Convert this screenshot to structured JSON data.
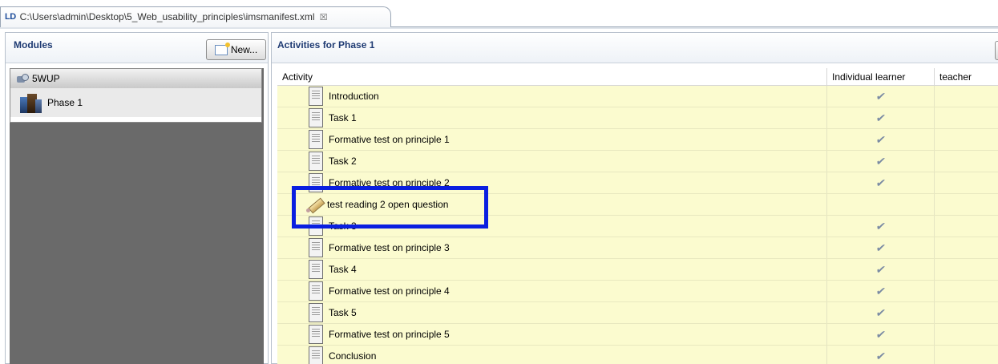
{
  "editor_tab": {
    "logo": "LD",
    "title": "C:\\Users\\admin\\Desktop\\5_Web_usability_principles\\imsmanifest.xml",
    "close": "☒"
  },
  "modules_panel": {
    "title": "Modules",
    "new_button": "New...",
    "tree": [
      {
        "label": "5WUP",
        "icon": "package-icon"
      },
      {
        "label": "Phase 1",
        "icon": "phase-icon"
      }
    ]
  },
  "activities_panel": {
    "title": "Activities for Phase 1",
    "columns": [
      "Activity",
      "Individual learner",
      "teacher"
    ],
    "check_glyph": "✔",
    "rows": [
      {
        "label": "Introduction",
        "icon": "document-icon",
        "learner": true,
        "teacher": false
      },
      {
        "label": "Task 1",
        "icon": "document-icon",
        "learner": true,
        "teacher": false
      },
      {
        "label": "Formative test on principle 1",
        "icon": "document-icon",
        "learner": true,
        "teacher": false
      },
      {
        "label": "Task 2",
        "icon": "document-icon",
        "learner": true,
        "teacher": false
      },
      {
        "label": "Formative test on principle 2",
        "icon": "document-icon",
        "learner": true,
        "teacher": false
      },
      {
        "label": "test reading 2 open question",
        "icon": "pen-icon",
        "learner": false,
        "teacher": true
      },
      {
        "label": "Task 3",
        "icon": "document-icon",
        "learner": true,
        "teacher": false
      },
      {
        "label": "Formative test on principle 3",
        "icon": "document-icon",
        "learner": true,
        "teacher": false
      },
      {
        "label": "Task 4",
        "icon": "document-icon",
        "learner": true,
        "teacher": false
      },
      {
        "label": "Formative test on principle 4",
        "icon": "document-icon",
        "learner": true,
        "teacher": false
      },
      {
        "label": "Task 5",
        "icon": "document-icon",
        "learner": true,
        "teacher": false
      },
      {
        "label": "Formative test on principle 5",
        "icon": "document-icon",
        "learner": true,
        "teacher": false
      },
      {
        "label": "Conclusion",
        "icon": "document-icon",
        "learner": true,
        "teacher": false
      }
    ]
  },
  "colors": {
    "row_background": "#fbfbcf",
    "highlight_border": "#0a1fe0",
    "header_text": "#1f3b73"
  }
}
